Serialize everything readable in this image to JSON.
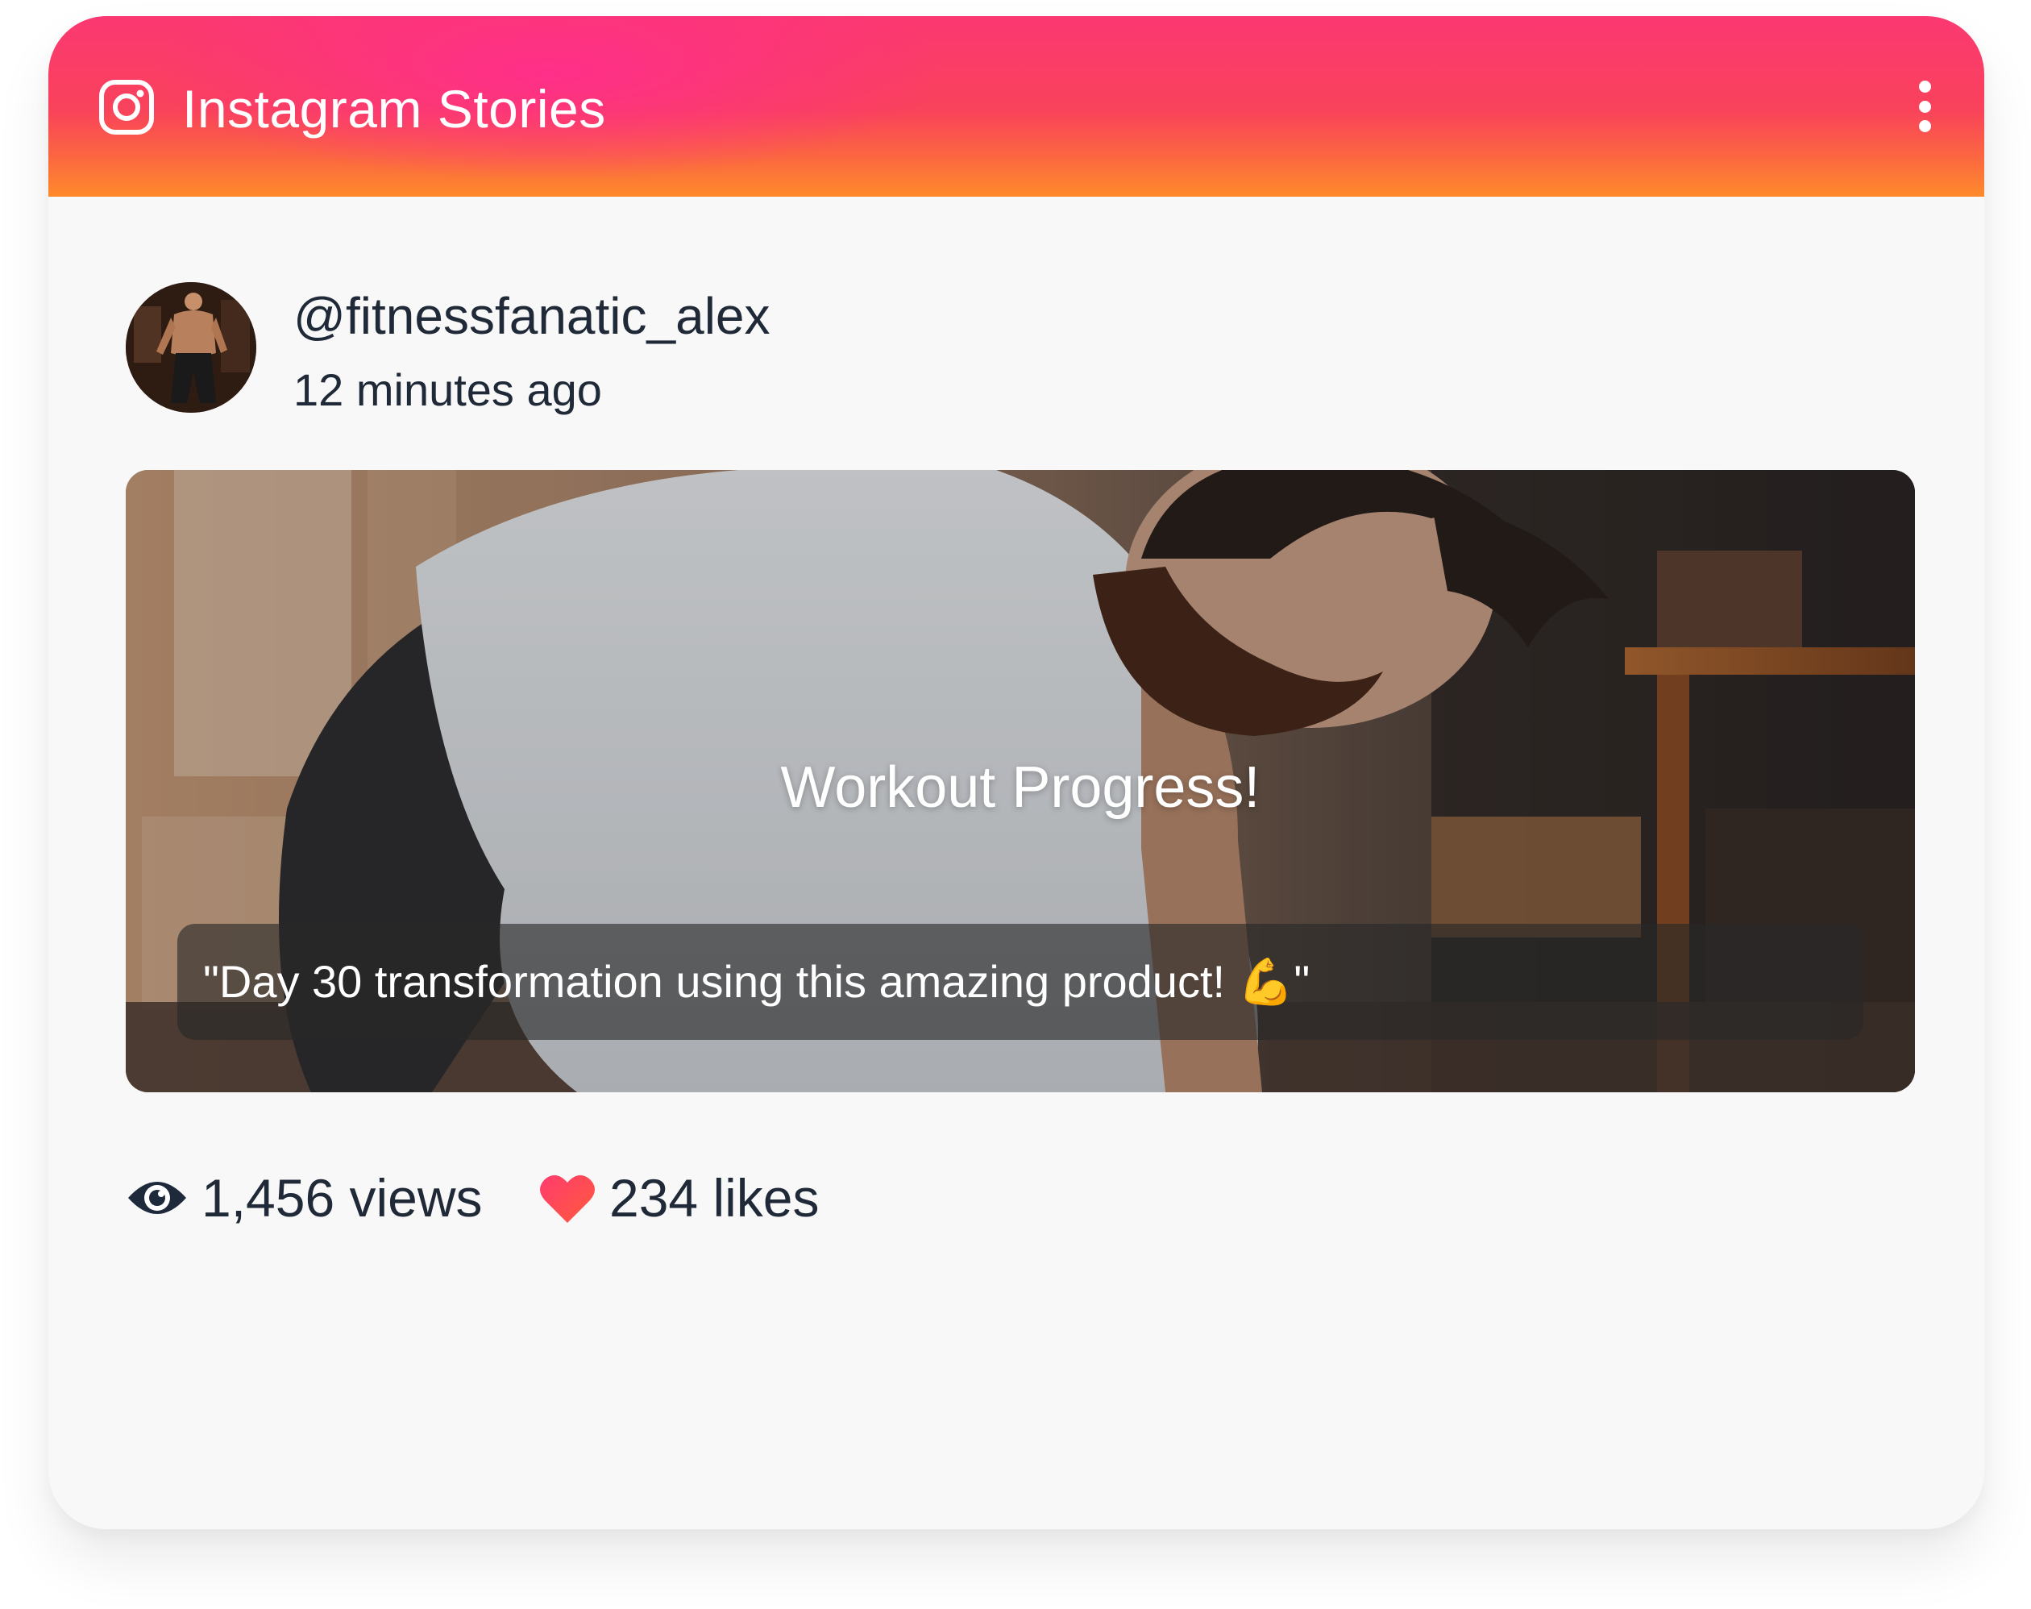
{
  "header": {
    "title": "Instagram Stories",
    "icon": "instagram-icon",
    "menu_icon": "more-vertical-icon",
    "gradient_colors": [
      "#fb2f8b",
      "#f9425b",
      "#fe8a2b"
    ]
  },
  "post": {
    "username": "@fitnessfanatic_alex",
    "timestamp": "12 minutes ago",
    "avatar_icon": "avatar",
    "story": {
      "title": "Workout Progress!",
      "caption": "\"Day 30 transformation using this amazing product! 💪\""
    }
  },
  "stats": {
    "views": "1,456 views",
    "likes": "234 likes",
    "views_icon": "eye-icon",
    "likes_icon": "heart-icon",
    "heart_colors": [
      "#ff3c6e",
      "#ff5a3c"
    ]
  }
}
